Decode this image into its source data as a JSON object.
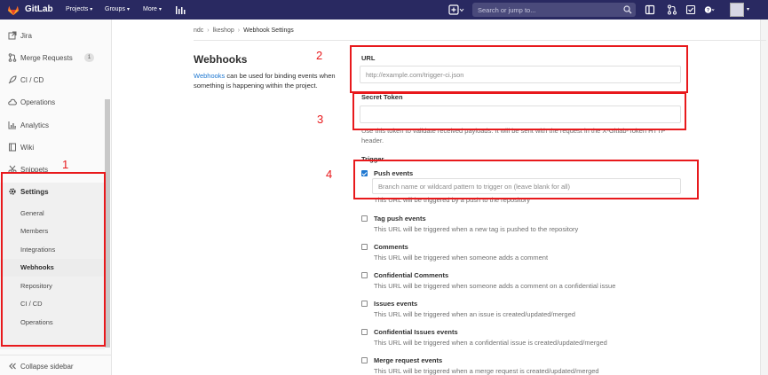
{
  "navbar": {
    "brand": "GitLab",
    "menus": [
      {
        "label": "Projects"
      },
      {
        "label": "Groups"
      },
      {
        "label": "More"
      }
    ],
    "search_placeholder": "Search or jump to..."
  },
  "sidebar": {
    "items": [
      {
        "label": "Jira",
        "icon": "external-link-icon"
      },
      {
        "label": "Merge Requests",
        "icon": "merge-request-icon",
        "badge": "1"
      },
      {
        "label": "CI / CD",
        "icon": "rocket-icon"
      },
      {
        "label": "Operations",
        "icon": "cloud-icon"
      },
      {
        "label": "Analytics",
        "icon": "chart-icon"
      },
      {
        "label": "Wiki",
        "icon": "book-icon"
      },
      {
        "label": "Snippets",
        "icon": "scissors-icon"
      },
      {
        "label": "Settings",
        "icon": "gear-icon"
      }
    ],
    "settings_sub": [
      {
        "label": "General"
      },
      {
        "label": "Members"
      },
      {
        "label": "Integrations"
      },
      {
        "label": "Webhooks"
      },
      {
        "label": "Repository"
      },
      {
        "label": "CI / CD"
      },
      {
        "label": "Operations"
      }
    ],
    "collapse_label": "Collapse sidebar"
  },
  "breadcrumb": {
    "items": [
      "ndc",
      "lkeshop",
      "Webhook Settings"
    ]
  },
  "page": {
    "title": "Webhooks",
    "desc_link": "Webhooks",
    "desc_text": " can be used for binding events when something is happening within the project."
  },
  "form": {
    "url_label": "URL",
    "url_placeholder": "http://example.com/trigger-ci.json",
    "secret_label": "Secret Token",
    "secret_value": "",
    "secret_help": "Use this token to validate received payloads. It will be sent with the request in the X-Gitlab-Token HTTP header.",
    "trigger_label": "Trigger",
    "push_title": "Push events",
    "push_branch_placeholder": "Branch name or wildcard pattern to trigger on (leave blank for all)",
    "push_desc": "This URL will be triggered by a push to the repository",
    "events": [
      {
        "title": "Tag push events",
        "desc": "This URL will be triggered when a new tag is pushed to the repository",
        "checked": false
      },
      {
        "title": "Comments",
        "desc": "This URL will be triggered when someone adds a comment",
        "checked": false
      },
      {
        "title": "Confidential Comments",
        "desc": "This URL will be triggered when someone adds a comment on a confidential issue",
        "checked": false
      },
      {
        "title": "Issues events",
        "desc": "This URL will be triggered when an issue is created/updated/merged",
        "checked": false
      },
      {
        "title": "Confidential Issues events",
        "desc": "This URL will be triggered when a confidential issue is created/updated/merged",
        "checked": false
      },
      {
        "title": "Merge request events",
        "desc": "This URL will be triggered when a merge request is created/updated/merged",
        "checked": false
      }
    ]
  },
  "annotations": {
    "n1": "1",
    "n2": "2",
    "n3": "3",
    "n4": "4"
  },
  "colors": {
    "navbar": "#292961",
    "link": "#1f78d1",
    "annotation": "#e8191c"
  }
}
